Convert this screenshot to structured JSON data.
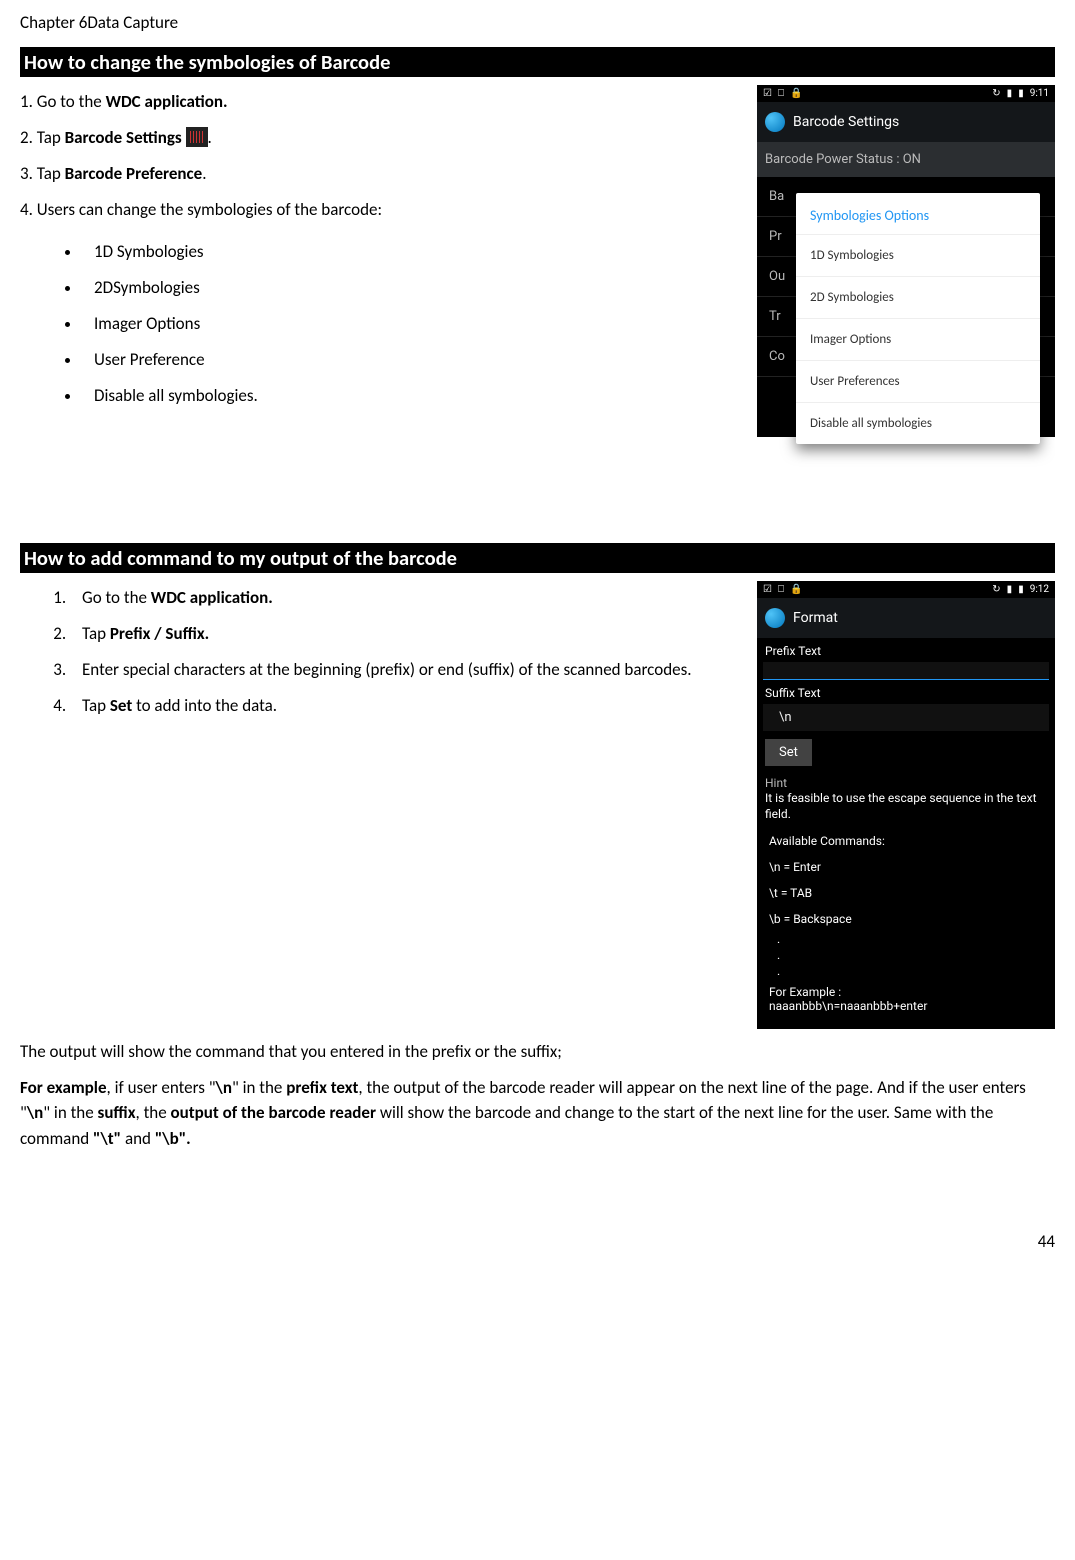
{
  "chapter": "Chapter 6Data Capture",
  "section1_title": "How to change the symbologies of Barcode",
  "s1_step1_a": "1. Go to the ",
  "s1_step1_b": "WDC application.",
  "s1_step2_a": "2. Tap ",
  "s1_step2_b": "Barcode Settings ",
  "s1_step2_c": ".",
  "s1_step3_a": "3. Tap ",
  "s1_step3_b": "Barcode Preference",
  "s1_step3_c": ".",
  "s1_step4": "4. Users can change the symbologies of the barcode:",
  "s1_bullets": [
    "1D Symbologies",
    "2DSymbologies",
    "Imager Options",
    "User Preference",
    "Disable all symbologies."
  ],
  "phone1": {
    "time": "9:11",
    "app_title": "Barcode Settings",
    "power": "Barcode Power Status : ON",
    "bg_rows": [
      "Ba",
      "Pr",
      "Ou",
      "Tr",
      "Co"
    ],
    "dialog_title": "Symbologies Options",
    "options": [
      "1D Symbologies",
      "2D Symbologies",
      "Imager Options",
      "User Preferences",
      "Disable all symbologies"
    ]
  },
  "section2_title": "How to add command to my output of the barcode",
  "s2_steps": {
    "a1": "Go to the ",
    "b1": "WDC application.",
    "a2": "Tap ",
    "b2": "Prefix / Suffix.",
    "a3": "Enter special characters at the beginning (prefix) or end (suffix) of the scanned barcodes.",
    "a4": "Tap ",
    "b4": "Set",
    "c4": " to add into the data."
  },
  "phone2": {
    "time": "9:12",
    "app_title": "Format",
    "prefix_label": "Prefix Text",
    "prefix_value": "",
    "suffix_label": "Suffix Text",
    "suffix_value": "\\n",
    "set": "Set",
    "hint_label": "Hint",
    "hint_text": "It is feasible to use the escape sequence in the text field.",
    "commands_title": "Available Commands:",
    "commands": [
      "\\n = Enter",
      "\\t = TAB",
      "\\b = Backspace"
    ],
    "example_label": "For Example :",
    "example_text": "naaanbbb\\n=naaanbbb+enter"
  },
  "out_para": "The output will show the command that you entered in the prefix or the suffix;",
  "ex": {
    "t1": "For example",
    "t2": ", if user enters \"",
    "t3": "\\n",
    "t4": "\" in the ",
    "t5": "prefix text",
    "t6": ", the output of the barcode reader will appear on the next line of the page. And if the user enters \"",
    "t7": "\\n",
    "t8": "\" in the ",
    "t9": "suffix",
    "t10": ", the ",
    "t11": "output of the barcode reader",
    "t12": " will show the barcode and change to the start of the next line for the user. Same with the command ",
    "t13": "\"\\t\"",
    "t14": " and ",
    "t15": "\"\\b\"."
  },
  "page_number": "44"
}
